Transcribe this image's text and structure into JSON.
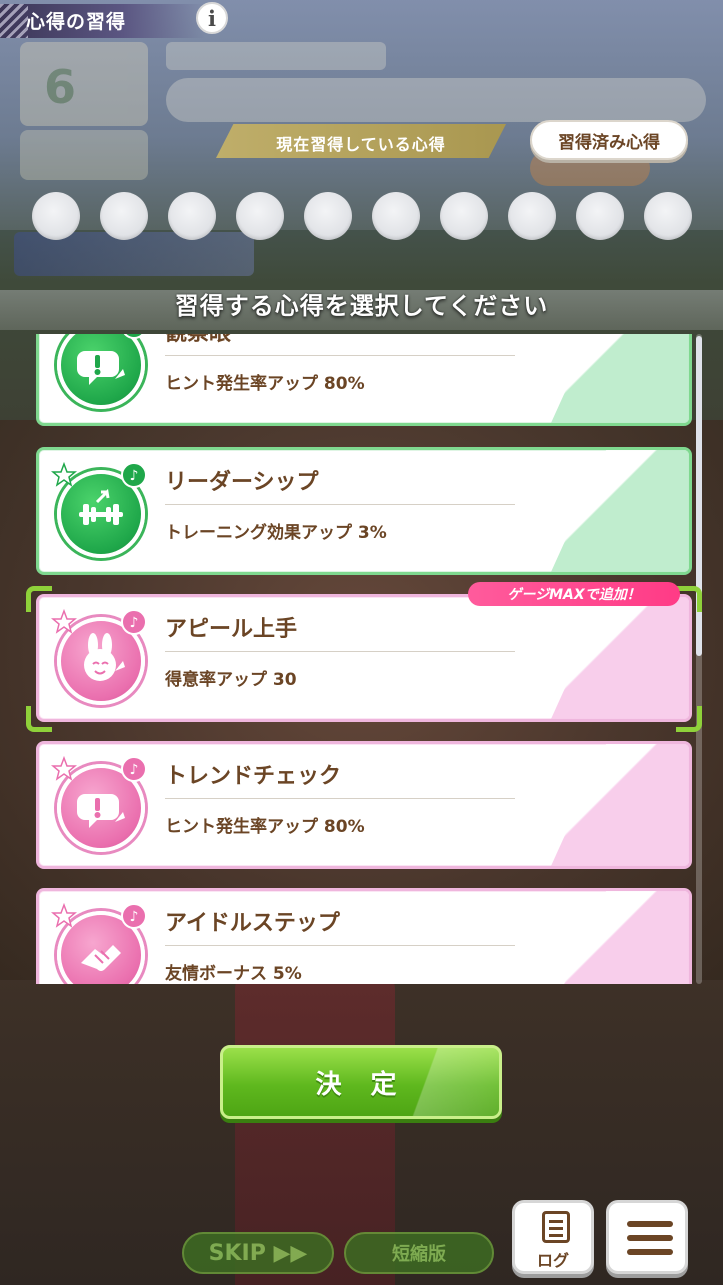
{
  "header": {
    "title": "心得の習得",
    "info_icon_glyph": "i"
  },
  "hud": {
    "turn_number": "6"
  },
  "current_section": {
    "label": "現在習得している心得",
    "learned_button_label": "習得済み心得",
    "slot_count": 10
  },
  "instruction": "習得する心得を選択してください",
  "cards": [
    {
      "name": "観察眼",
      "effect": "ヒント発生率アップ 80%",
      "theme": "green",
      "icon": "hint-exclamation-icon"
    },
    {
      "name": "リーダーシップ",
      "effect": "トレーニング効果アップ 3%",
      "theme": "green",
      "icon": "dumbbell-icon"
    },
    {
      "name": "アピール上手",
      "effect": "得意率アップ 30",
      "theme": "pink",
      "icon": "rabbit-face-icon",
      "selected": true
    },
    {
      "name": "トレンドチェック",
      "effect": "ヒント発生率アップ 80%",
      "theme": "pink",
      "icon": "hint-exclamation-icon"
    },
    {
      "name": "アイドルステップ",
      "effect": "友情ボーナス 5%",
      "theme": "pink",
      "icon": "handshake-icon"
    }
  ],
  "selected_tag": "ゲージMAXで追加！",
  "decide_button": "決 定",
  "bottom": {
    "skip_label": "SKIP ▶▶",
    "short_label": "短縮版",
    "log_label": "ログ",
    "menu_icon": "menu-icon"
  },
  "colors": {
    "green_border": "#7fd88f",
    "pink_border": "#efb6dd",
    "text_brown": "#6b4525",
    "accent_pink": "#ff3b86",
    "decide_green": "#5fb81e"
  }
}
